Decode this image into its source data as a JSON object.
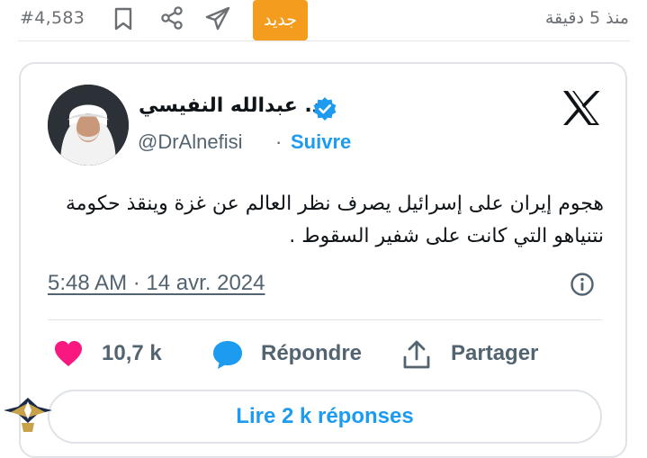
{
  "topbar": {
    "post_number": "#4,583",
    "new_badge": "جديد",
    "time_ago": "منذ 5 دقيقة",
    "icons": [
      "bookmark-icon",
      "share-icon",
      "send-icon"
    ]
  },
  "tweet": {
    "author_name": "د. عبدالله النفيسي",
    "verified": true,
    "handle": "@DrAlnefisi",
    "separator": "·",
    "follow_label": "Suivre",
    "text": "هجوم إيران على إسرائيل يصرف نظر العالم عن غزة وينقذ حكومة نتنياهو التي كانت على شفير السقوط .",
    "timestamp": "5:48 AM · 14 avr. 2024",
    "like_count": "10,7 k",
    "reply_label": "Répondre",
    "share_label": "Partager",
    "read_replies_label": "Lire 2 k réponses"
  },
  "colors": {
    "accent_blue": "#1d9bf0",
    "badge_orange": "#f39c1d",
    "like_pink": "#f91880",
    "muted_text": "#536471"
  }
}
